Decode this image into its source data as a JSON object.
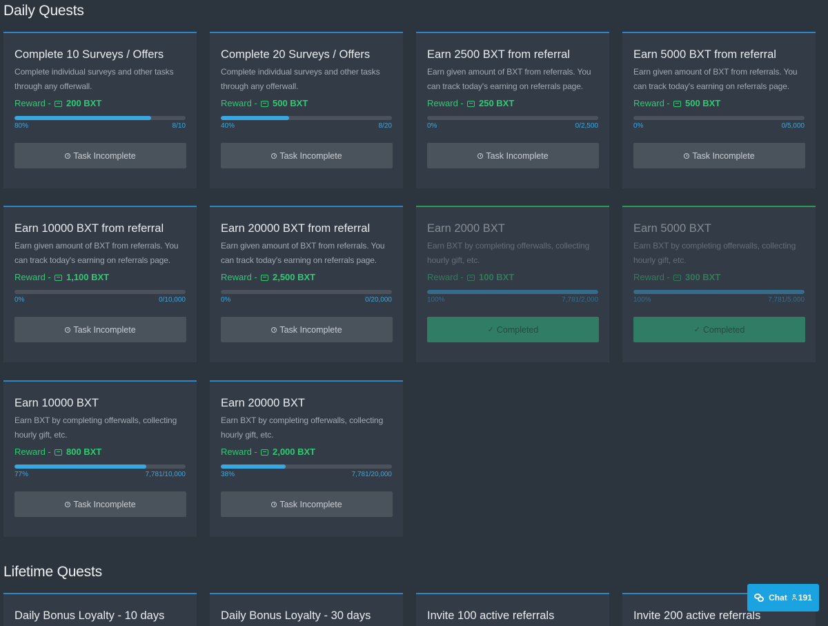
{
  "sections": {
    "daily_title": "Daily Quests",
    "lifetime_title": "Lifetime Quests"
  },
  "colors": {
    "accent": "#3aa8e0",
    "reward_green": "#2ecc71",
    "completed_button": "#2ecc8b",
    "card_bg": "#333b46"
  },
  "reward_prefix": "Reward - ",
  "daily_quests": [
    {
      "title": "Complete 10 Surveys / Offers",
      "desc": "Complete individual surveys and other tasks through any offerwall.",
      "reward": "200 BXT",
      "percent": "80%",
      "progress": "8/10",
      "fill": 0.8,
      "button": "Task Incomplete",
      "done": false
    },
    {
      "title": "Complete 20 Surveys / Offers",
      "desc": "Complete individual surveys and other tasks through any offerwall.",
      "reward": "500 BXT",
      "percent": "40%",
      "progress": "8/20",
      "fill": 0.4,
      "button": "Task Incomplete",
      "done": false
    },
    {
      "title": "Earn 2500 BXT from referral",
      "desc": "Earn given amount of BXT from referrals. You can track today's earning on referrals page.",
      "reward": "250 BXT",
      "percent": "0%",
      "progress": "0/2,500",
      "fill": 0,
      "button": "Task Incomplete",
      "done": false
    },
    {
      "title": "Earn 5000 BXT from referral",
      "desc": "Earn given amount of BXT from referrals. You can track today's earning on referrals page.",
      "reward": "500 BXT",
      "percent": "0%",
      "progress": "0/5,000",
      "fill": 0,
      "button": "Task Incomplete",
      "done": false
    },
    {
      "title": "Earn 10000 BXT from referral",
      "desc": "Earn given amount of BXT from referrals. You can track today's earning on referrals page.",
      "reward": "1,100 BXT",
      "percent": "0%",
      "progress": "0/10,000",
      "fill": 0,
      "button": "Task Incomplete",
      "done": false
    },
    {
      "title": "Earn 20000 BXT from referral",
      "desc": "Earn given amount of BXT from referrals. You can track today's earning on referrals page.",
      "reward": "2,500 BXT",
      "percent": "0%",
      "progress": "0/20,000",
      "fill": 0,
      "button": "Task Incomplete",
      "done": false
    },
    {
      "title": "Earn 2000 BXT",
      "desc": "Earn BXT by completing offerwalls, collecting hourly gift, etc.",
      "reward": "100 BXT",
      "percent": "100%",
      "progress": "7,781/2,000",
      "fill": 1,
      "button": "Completed",
      "done": true
    },
    {
      "title": "Earn 5000 BXT",
      "desc": "Earn BXT by completing offerwalls, collecting hourly gift, etc.",
      "reward": "300 BXT",
      "percent": "100%",
      "progress": "7,781/5,000",
      "fill": 1,
      "button": "Completed",
      "done": true
    },
    {
      "title": "Earn 10000 BXT",
      "desc": "Earn BXT by completing offerwalls, collecting hourly gift, etc.",
      "reward": "800 BXT",
      "percent": "77%",
      "progress": "7,781/10,000",
      "fill": 0.77,
      "button": "Task Incomplete",
      "done": false
    },
    {
      "title": "Earn 20000 BXT",
      "desc": "Earn BXT by completing offerwalls, collecting hourly gift, etc.",
      "reward": "2,000 BXT",
      "percent": "38%",
      "progress": "7,781/20,000",
      "fill": 0.38,
      "button": "Task Incomplete",
      "done": false
    }
  ],
  "lifetime_quests": [
    {
      "title": "Daily Bonus Loyalty - 10 days"
    },
    {
      "title": "Daily Bonus Loyalty - 30 days"
    },
    {
      "title": "Invite 100 active referrals"
    },
    {
      "title": "Invite 200 active referrals"
    }
  ],
  "chat": {
    "label": "Chat",
    "online_count": "191"
  }
}
